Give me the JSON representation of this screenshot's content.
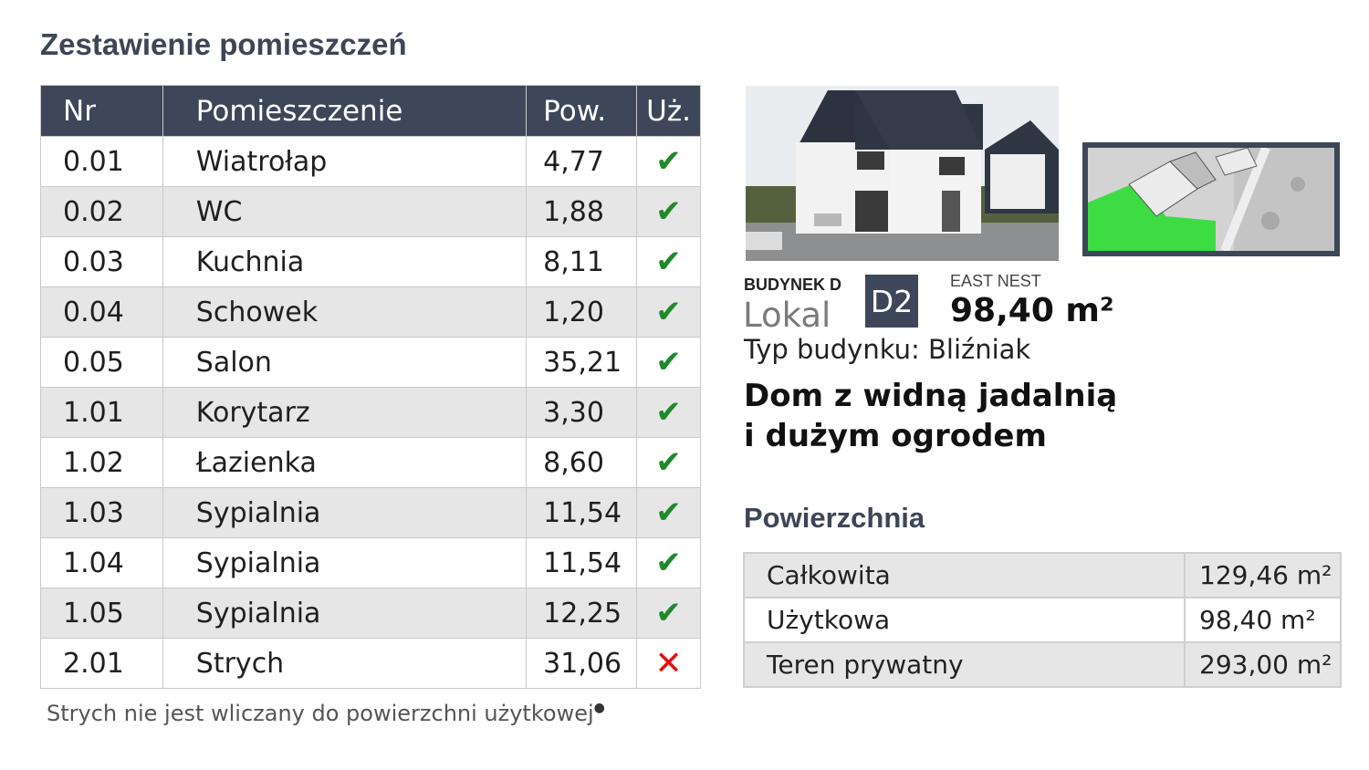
{
  "title": "Zestawienie pomieszczeń",
  "rooms_table": {
    "headers": [
      "Nr",
      "Pomieszczenie",
      "Pow.",
      "Uż."
    ],
    "rows": [
      {
        "nr": "0.01",
        "name": "Wiatrołap",
        "area": "4,77",
        "usable": true
      },
      {
        "nr": "0.02",
        "name": "WC",
        "area": "1,88",
        "usable": true
      },
      {
        "nr": "0.03",
        "name": "Kuchnia",
        "area": "8,11",
        "usable": true
      },
      {
        "nr": "0.04",
        "name": "Schowek",
        "area": "1,20",
        "usable": true
      },
      {
        "nr": "0.05",
        "name": "Salon",
        "area": "35,21",
        "usable": true
      },
      {
        "nr": "1.01",
        "name": "Korytarz",
        "area": "3,30",
        "usable": true
      },
      {
        "nr": "1.02",
        "name": "Łazienka",
        "area": "8,60",
        "usable": true
      },
      {
        "nr": "1.03",
        "name": "Sypialnia",
        "area": "11,54",
        "usable": true
      },
      {
        "nr": "1.04",
        "name": "Sypialnia",
        "area": "11,54",
        "usable": true
      },
      {
        "nr": "1.05",
        "name": "Sypialnia",
        "area": "12,25",
        "usable": true
      },
      {
        "nr": "2.01",
        "name": "Strych",
        "area": "31,06",
        "usable": false
      }
    ]
  },
  "note": "Strych nie jest wliczany do powierzchni użytkowej",
  "note_mark": "●",
  "icons": {
    "usable": "check-icon",
    "not_usable": "cross-icon"
  },
  "colors": {
    "header_bg": "#3d4759",
    "check": "#1f8a2a",
    "cross": "#e21010",
    "plot_highlight": "#3ddc45"
  },
  "property": {
    "building": "BUDYNEK D",
    "unit_label": "Lokal",
    "unit_code": "D2",
    "investment": "EAST NEST",
    "area": "98,40 m²",
    "type": "Typ budynku: Bliźniak",
    "headline_1": "Dom z widną jadalnią",
    "headline_2": "i dużym ogrodem"
  },
  "surfaces": {
    "title": "Powierzchnia",
    "rows": [
      {
        "label": "Całkowita",
        "value": "129,46 m²"
      },
      {
        "label": "Użytkowa",
        "value": "98,40 m²"
      },
      {
        "label": "Teren prywatny",
        "value": "293,00 m²"
      }
    ]
  }
}
